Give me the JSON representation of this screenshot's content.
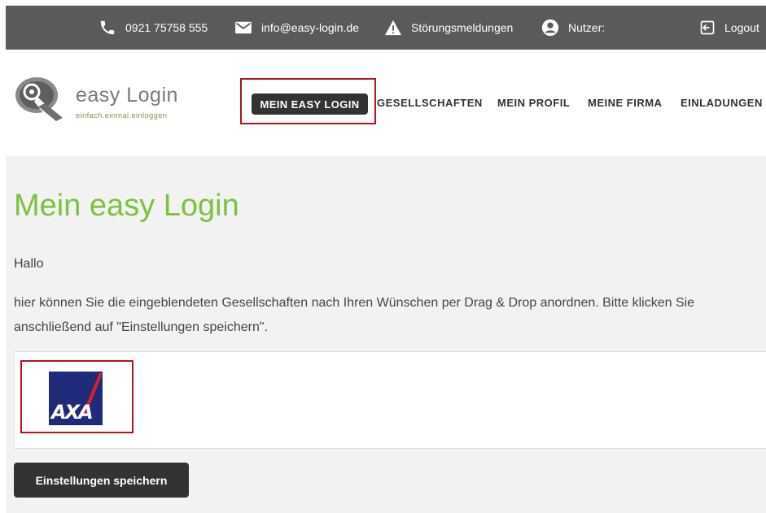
{
  "topbar": {
    "phone": "0921 75758 555",
    "email": "info@easy-login.de",
    "alerts": "Störungsmeldungen",
    "user": "Nutzer:",
    "logout": "Logout",
    "icons": [
      "phone-icon",
      "mail-icon",
      "warning-icon",
      "user-icon",
      "logout-icon"
    ]
  },
  "logo": {
    "name": "easy Login",
    "tagline": "einfach.einmal.einloggen"
  },
  "nav": {
    "items": [
      {
        "label": "MEIN EASY LOGIN",
        "active": true
      },
      {
        "label": "GESELLSCHAFTEN",
        "active": false
      },
      {
        "label": "MEIN PROFIL",
        "active": false
      },
      {
        "label": "MEINE FIRMA",
        "active": false
      },
      {
        "label": "EINLADUNGEN",
        "active": false
      }
    ]
  },
  "main": {
    "title": "Mein easy Login",
    "greeting": "Hallo",
    "intro": "hier können Sie die eingeblendeten Gesellschaften nach Ihren Wünschen per Drag & Drop anordnen. Bitte klicken Sie anschließend auf \"Einstellungen speichern\".",
    "companies": [
      {
        "name": "AXA",
        "logo": "axa-logo"
      }
    ],
    "save_label": "Einstellungen speichern"
  },
  "colors": {
    "topbar_bg": "#5a5a5a",
    "accent_green": "#7dc141",
    "dark_button": "#333333",
    "highlight_red": "#b5121b",
    "axa_blue": "#1f2a7a",
    "axa_red": "#d2232a"
  }
}
